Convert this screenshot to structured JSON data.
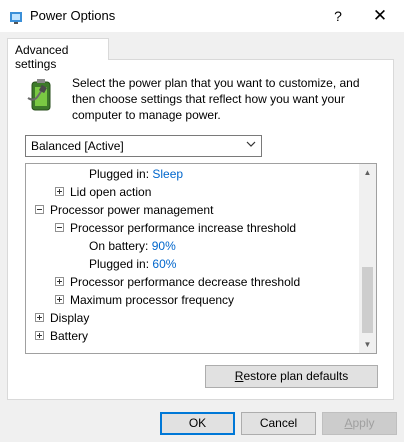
{
  "window": {
    "title": "Power Options",
    "help_label": "?",
    "close_label": "✕",
    "icon": "power-options-icon"
  },
  "tab": {
    "label": "Advanced settings"
  },
  "description": "Select the power plan that you want to customize, and then choose settings that reflect how you want your computer to manage power.",
  "plan": {
    "selected": "Balanced [Active]"
  },
  "tree": {
    "plugged_in_label": "Plugged in:",
    "plugged_in_value": "Sleep",
    "lid_open": "Lid open action",
    "processor_pm": "Processor power management",
    "perf_increase": "Processor performance increase threshold",
    "on_battery_label": "On battery:",
    "on_battery_value": "90%",
    "plugged_in_label2": "Plugged in:",
    "plugged_in_value2": "60%",
    "perf_decrease": "Processor performance decrease threshold",
    "max_freq": "Maximum processor frequency",
    "display": "Display",
    "battery": "Battery"
  },
  "buttons": {
    "restore_first": "R",
    "restore_rest": "estore plan defaults",
    "ok": "OK",
    "cancel": "Cancel",
    "apply_first": "A",
    "apply_rest": "pply"
  },
  "colors": {
    "link": "#0066cc",
    "accent": "#0078d7"
  }
}
